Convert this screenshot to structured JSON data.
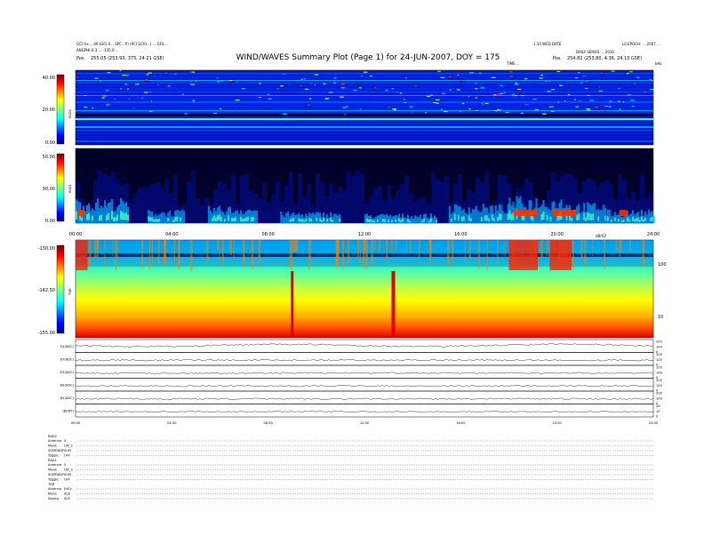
{
  "header": {
    "title": "WIND/WAVES Summary Plot (Page 1) for 24-JUN-2007, DOY = 175",
    "left_line1": "GCI 0+... 00 (GCI 0... SPC...P) (PCI GCI0...) ... GFS...",
    "left_line2": "ANGPHI-0.3 ... -135.0 ...",
    "left_pos_label": "Pos",
    "left_pos_value": "255.05 (253.93, 375, 24.21 GSE)",
    "center_small": "TIME ...",
    "right_line1": "1.10 WED DATE",
    "right_line2": "L0 EPOCH: ... 2007 ...",
    "right_line3": "DAILY SERIES ... 2016",
    "right_pos_label": "Pos",
    "right_pos_value": "254.82 (253.80, 4.36, 24.13 GSE)",
    "right_unit": "kHz"
  },
  "panels": [
    {
      "name": "RAD2",
      "colorbar_ticks": [
        "40.00",
        "20.00",
        "0.00"
      ],
      "colorbar_range": [
        0,
        40
      ],
      "y_label": "RAD2"
    },
    {
      "name": "RAD1",
      "colorbar_ticks": [
        "50.00",
        "30.00",
        "0.00"
      ],
      "colorbar_range": [
        0,
        50
      ],
      "y_label": "RAD1"
    },
    {
      "name": "TNR",
      "colorbar_ticks": [
        "-130.00",
        "-142.50",
        "-155.00"
      ],
      "colorbar_range": [
        -155,
        -130
      ],
      "y_label": "TNR",
      "right_ticks": [
        "100",
        "10"
      ],
      "right_unit": "dB/V2"
    }
  ],
  "time_ticks": [
    "00:00",
    "04:00",
    "08:00",
    "12:00",
    "16:00",
    "20:00",
    "24:00"
  ],
  "line_panels": [
    {
      "label": "EX(ADC)",
      "right_ticks": [
        "200",
        "100",
        "0"
      ]
    },
    {
      "label": "EY(ADC)",
      "right_ticks": [
        "200",
        "100",
        "0"
      ]
    },
    {
      "label": "EZ(ADC)",
      "right_ticks": [
        "200",
        "100",
        "0"
      ]
    },
    {
      "label": "BX(ADC)",
      "right_ticks": [
        "200",
        "100",
        "0"
      ]
    },
    {
      "label": "BY(ADC)",
      "right_ticks": [
        "200",
        "100",
        "0"
      ]
    },
    {
      "label": "|B|(NT)",
      "right_ticks": [
        "20",
        "10",
        "0"
      ]
    }
  ],
  "footer": {
    "rad2": {
      "title": "RAD2",
      "rows": [
        {
          "key": "Antenna",
          "value": "S"
        },
        {
          "key": "Mode",
          "value": "LIN_S"
        },
        {
          "key": "SUMDADF",
          "value": "SUM"
        },
        {
          "key": "Toggle",
          "value": "OFF"
        }
      ]
    },
    "rad1": {
      "title": "RAD1",
      "rows": [
        {
          "key": "Antenna",
          "value": "S"
        },
        {
          "key": "Mode",
          "value": "LIN_S"
        },
        {
          "key": "SUMDADF",
          "value": "SUM"
        },
        {
          "key": "Toggle",
          "value": "OFF"
        }
      ]
    },
    "tnr": {
      "title": "TNR",
      "rows": [
        {
          "key": "Antenna",
          "value": "ExEy"
        },
        {
          "key": "Mode",
          "value": "ACE"
        },
        {
          "key": "Sweep",
          "value": "ACE"
        }
      ]
    }
  },
  "chart_data": [
    {
      "type": "heatmap",
      "title": "RAD2",
      "ylabel": "RAD2",
      "x_range_hours": [
        0,
        24
      ],
      "z_range": [
        0,
        40
      ],
      "colormap": "jet",
      "features": "horizontal interference bands across full day"
    },
    {
      "type": "heatmap",
      "title": "RAD1",
      "ylabel": "RAD1",
      "x_range_hours": [
        0,
        24
      ],
      "z_range": [
        0,
        50
      ],
      "colormap": "jet",
      "features": "low-frequency bursts at 0-2h, 16-22h"
    },
    {
      "type": "heatmap",
      "title": "TNR",
      "ylabel": "TNR",
      "x_range_hours": [
        0,
        24
      ],
      "z_range": [
        -155,
        -130
      ],
      "colormap": "jet",
      "features": "vertical spikes near 09:00 and 13:15; bursts 18:00-21:00"
    },
    {
      "type": "line",
      "title": "EX(ADC)",
      "x_range_hours": [
        0,
        24
      ],
      "ylim": [
        0,
        200
      ]
    },
    {
      "type": "line",
      "title": "EY(ADC)",
      "x_range_hours": [
        0,
        24
      ],
      "ylim": [
        0,
        200
      ]
    },
    {
      "type": "line",
      "title": "EZ(ADC)",
      "x_range_hours": [
        0,
        24
      ],
      "ylim": [
        0,
        200
      ]
    },
    {
      "type": "line",
      "title": "BX(ADC)",
      "x_range_hours": [
        0,
        24
      ],
      "ylim": [
        0,
        200
      ]
    },
    {
      "type": "line",
      "title": "BY(ADC)",
      "x_range_hours": [
        0,
        24
      ],
      "ylim": [
        0,
        200
      ]
    },
    {
      "type": "line",
      "title": "|B|(NT)",
      "x_range_hours": [
        0,
        24
      ],
      "ylim": [
        0,
        20
      ]
    }
  ]
}
